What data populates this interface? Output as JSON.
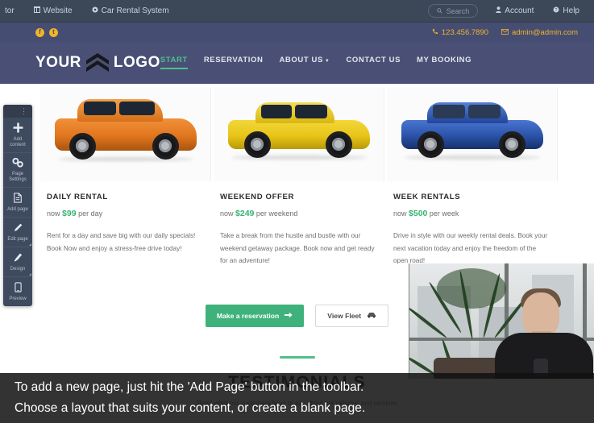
{
  "admin_bar": {
    "items": [
      {
        "label": "tor",
        "icon": "editor-icon"
      },
      {
        "label": "Website",
        "icon": "window-icon"
      },
      {
        "label": "Car Rental System",
        "icon": "gear-icon"
      }
    ],
    "search_placeholder": "Search",
    "account_label": "Account",
    "help_label": "Help"
  },
  "contact_strip": {
    "social": [
      {
        "name": "facebook-icon",
        "glyph": "f"
      },
      {
        "name": "twitter-icon",
        "glyph": "t"
      }
    ],
    "phone": "123.456.7890",
    "email": "admin@admin.com",
    "accent_color": "#f0b429"
  },
  "header": {
    "logo_first": "YOUR",
    "logo_second": "LOGO",
    "nav": [
      {
        "label": "START",
        "active": true,
        "dropdown": false
      },
      {
        "label": "RESERVATION",
        "active": false,
        "dropdown": false
      },
      {
        "label": "ABOUT US",
        "active": false,
        "dropdown": true
      },
      {
        "label": "CONTACT US",
        "active": false,
        "dropdown": false
      },
      {
        "label": "MY BOOKING",
        "active": false,
        "dropdown": false
      }
    ],
    "bg_color": "#4a5075",
    "accent_color": "#4fbf8b"
  },
  "toolbar": {
    "items": [
      {
        "label": "Add\ncontent",
        "icon": "plus-icon",
        "glyph": "➕"
      },
      {
        "label": "Page\nSettings",
        "icon": "gear-icon",
        "glyph": "⚙"
      },
      {
        "label": "Add page",
        "icon": "document-icon",
        "glyph": "὜E"
      },
      {
        "label": "Edit page",
        "icon": "pencil-icon",
        "glyph": "✎"
      },
      {
        "label": "Design",
        "icon": "brush-icon",
        "glyph": "✐"
      },
      {
        "label": "Preview",
        "icon": "mobile-icon",
        "glyph": "▯"
      }
    ],
    "handle_glyph": "⋮"
  },
  "cards": [
    {
      "title": "DAILY RENTAL",
      "price_prefix": "now",
      "price": "$99",
      "price_suffix": "per day",
      "description": "Rent for a day and save big with our daily specials! Book Now and enjoy a stress-free drive today!",
      "car_color": "#e1751d",
      "car_color_dark": "#b85c12",
      "car_type": "suv"
    },
    {
      "title": "WEEKEND OFFER",
      "price_prefix": "now",
      "price": "$249",
      "price_suffix": "per weekend",
      "description": "Take a break from the hustle and bustle with our weekend getaway package. Book now and get ready for an adventure!",
      "car_color": "#e8c417",
      "car_color_dark": "#c4a40c",
      "car_type": "sedan"
    },
    {
      "title": "WEEK RENTALS",
      "price_prefix": "now",
      "price": "$500",
      "price_suffix": "per week",
      "description": "Drive in style with our weekly rental deals. Book your next vacation today and enjoy the freedom of the open road!",
      "car_color": "#2a52a8",
      "car_color_dark": "#1d3d82",
      "car_type": "sedan"
    }
  ],
  "cta": {
    "primary_label": "Make a reservation",
    "primary_icon": "arrow-right-icon",
    "primary_glyph": "➡",
    "primary_color": "#3fb27c",
    "secondary_label": "View Fleet",
    "secondary_icon": "car-icon",
    "secondary_glyph": "🚗"
  },
  "testimonials": {
    "title": "TESTIMONIALS",
    "subtitle": "Read what our customers have to say about our vehicles and services",
    "rule_color": "#4fbf8b"
  },
  "caption": {
    "line1": "To add a new page, just hit the 'Add Page' button in the toolbar.",
    "line2": "Choose a layout that suits your content, or create a blank page."
  },
  "prices_accent_color": "#34b473"
}
